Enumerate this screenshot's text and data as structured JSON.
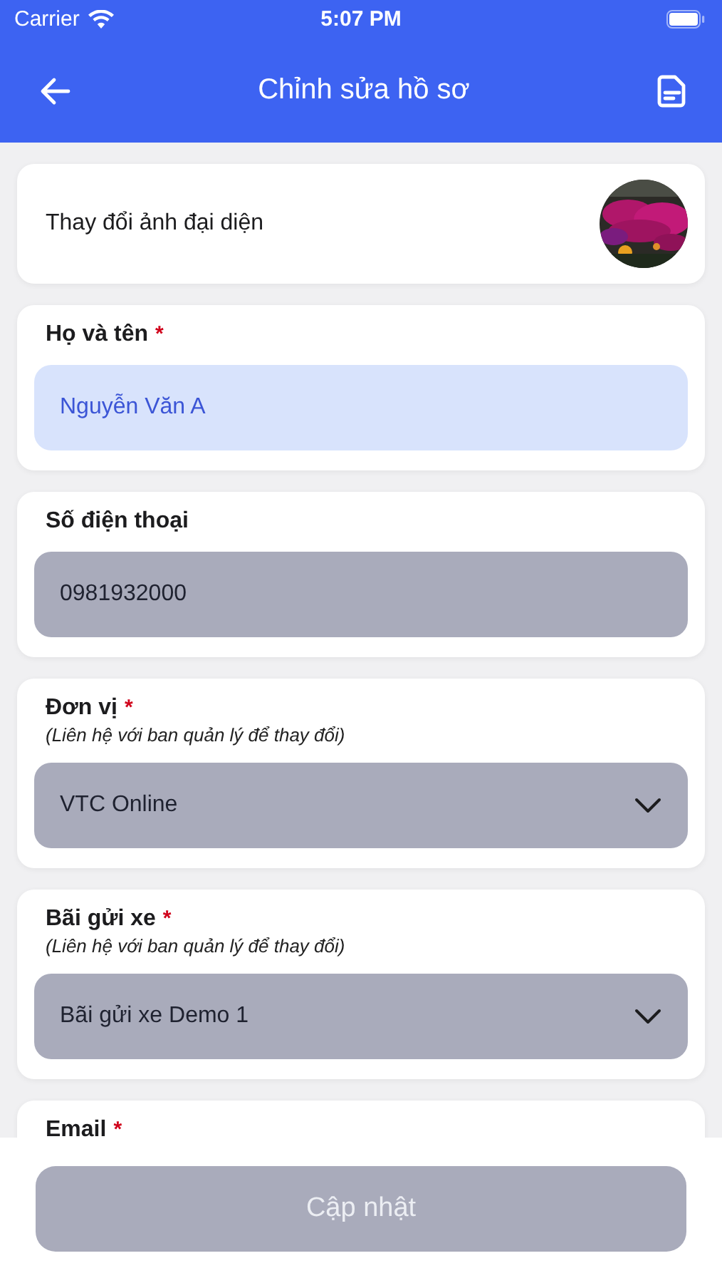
{
  "status_bar": {
    "carrier": "Carrier",
    "time": "5:07 PM"
  },
  "header": {
    "title": "Chỉnh sửa hồ sơ"
  },
  "avatar_row": {
    "label": "Thay đổi ảnh đại diện"
  },
  "fields": [
    {
      "label": "Họ và tên",
      "required_mark": "*",
      "kind": "text",
      "disabled": false,
      "value": "Nguyễn Văn A"
    },
    {
      "label": "Số điện thoại",
      "kind": "text",
      "disabled": true,
      "value": "0981932000"
    },
    {
      "label": "Đơn vị",
      "required_mark": "*",
      "note": "(Liên hệ với ban quản lý để thay đổi)",
      "kind": "select",
      "disabled": true,
      "value": "VTC Online"
    },
    {
      "label": "Bãi gửi xe",
      "required_mark": "*",
      "note": "(Liên hệ với ban quản lý để thay đổi)",
      "kind": "select",
      "disabled": true,
      "value": "Bãi gửi xe Demo 1"
    },
    {
      "label": "Email",
      "required_mark": "*",
      "kind": "partial"
    }
  ],
  "submit": {
    "label": "Cập nhật",
    "disabled": true
  }
}
